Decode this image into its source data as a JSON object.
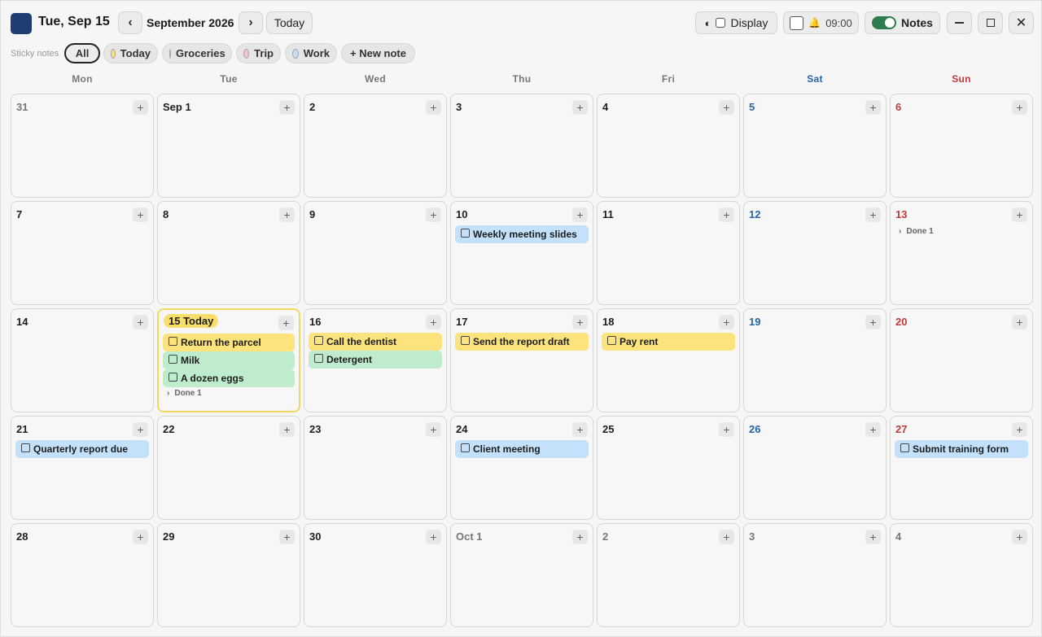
{
  "header": {
    "date_title": "Tue, Sep 15",
    "month_label": "September 2026",
    "today_button": "Today",
    "display_button": "Display",
    "alarm_time": "09:00",
    "notes_toggle_label": "Notes",
    "brand_color": "#1f3c73"
  },
  "filters": {
    "label": "Sticky notes",
    "all": "All",
    "today": "Today",
    "groceries": "Groceries",
    "trip": "Trip",
    "work": "Work",
    "new_note": "+ New note",
    "colors": {
      "today": "#fbe27a",
      "groceries": "#bfecd2",
      "trip": "#f7c2cf",
      "work": "#c4ddf6"
    }
  },
  "weekdays": [
    "Mon",
    "Tue",
    "Wed",
    "Thu",
    "Fri",
    "Sat",
    "Sun"
  ],
  "weeks": [
    [
      {
        "label": "31",
        "kind": "other"
      },
      {
        "label": "Sep 1",
        "kind": "normal"
      },
      {
        "label": "2",
        "kind": "normal"
      },
      {
        "label": "3",
        "kind": "normal"
      },
      {
        "label": "4",
        "kind": "normal"
      },
      {
        "label": "5",
        "kind": "sat"
      },
      {
        "label": "6",
        "kind": "sun"
      }
    ],
    [
      {
        "label": "7",
        "kind": "normal"
      },
      {
        "label": "8",
        "kind": "normal"
      },
      {
        "label": "9",
        "kind": "normal"
      },
      {
        "label": "10",
        "kind": "normal",
        "notes": [
          {
            "text": "Weekly meeting slides",
            "color": "blue"
          }
        ]
      },
      {
        "label": "11",
        "kind": "normal"
      },
      {
        "label": "12",
        "kind": "sat"
      },
      {
        "label": "13",
        "kind": "sun",
        "done": "Done 1"
      }
    ],
    [
      {
        "label": "14",
        "kind": "normal"
      },
      {
        "label": "15 Today",
        "kind": "today",
        "notes": [
          {
            "text": "Return the parcel",
            "color": "yellow"
          },
          {
            "text": "Milk",
            "color": "green"
          },
          {
            "text": "A dozen eggs",
            "color": "green"
          }
        ],
        "done": "Done 1"
      },
      {
        "label": "16",
        "kind": "normal",
        "notes": [
          {
            "text": "Call the dentist",
            "color": "yellow"
          },
          {
            "text": "Detergent",
            "color": "green"
          }
        ]
      },
      {
        "label": "17",
        "kind": "normal",
        "notes": [
          {
            "text": "Send the report draft",
            "color": "yellow"
          }
        ]
      },
      {
        "label": "18",
        "kind": "normal",
        "notes": [
          {
            "text": "Pay rent",
            "color": "yellow"
          }
        ]
      },
      {
        "label": "19",
        "kind": "sat"
      },
      {
        "label": "20",
        "kind": "sun"
      }
    ],
    [
      {
        "label": "21",
        "kind": "normal",
        "notes": [
          {
            "text": "Quarterly report due",
            "color": "blue"
          }
        ]
      },
      {
        "label": "22",
        "kind": "normal"
      },
      {
        "label": "23",
        "kind": "normal"
      },
      {
        "label": "24",
        "kind": "normal",
        "notes": [
          {
            "text": "Client meeting",
            "color": "blue"
          }
        ]
      },
      {
        "label": "25",
        "kind": "normal"
      },
      {
        "label": "26",
        "kind": "sat"
      },
      {
        "label": "27",
        "kind": "sun",
        "notes": [
          {
            "text": "Submit training form",
            "color": "blue"
          }
        ]
      }
    ],
    [
      {
        "label": "28",
        "kind": "normal"
      },
      {
        "label": "29",
        "kind": "normal"
      },
      {
        "label": "30",
        "kind": "normal"
      },
      {
        "label": "Oct 1",
        "kind": "other"
      },
      {
        "label": "2",
        "kind": "other"
      },
      {
        "label": "3",
        "kind": "other"
      },
      {
        "label": "4",
        "kind": "other"
      }
    ]
  ]
}
